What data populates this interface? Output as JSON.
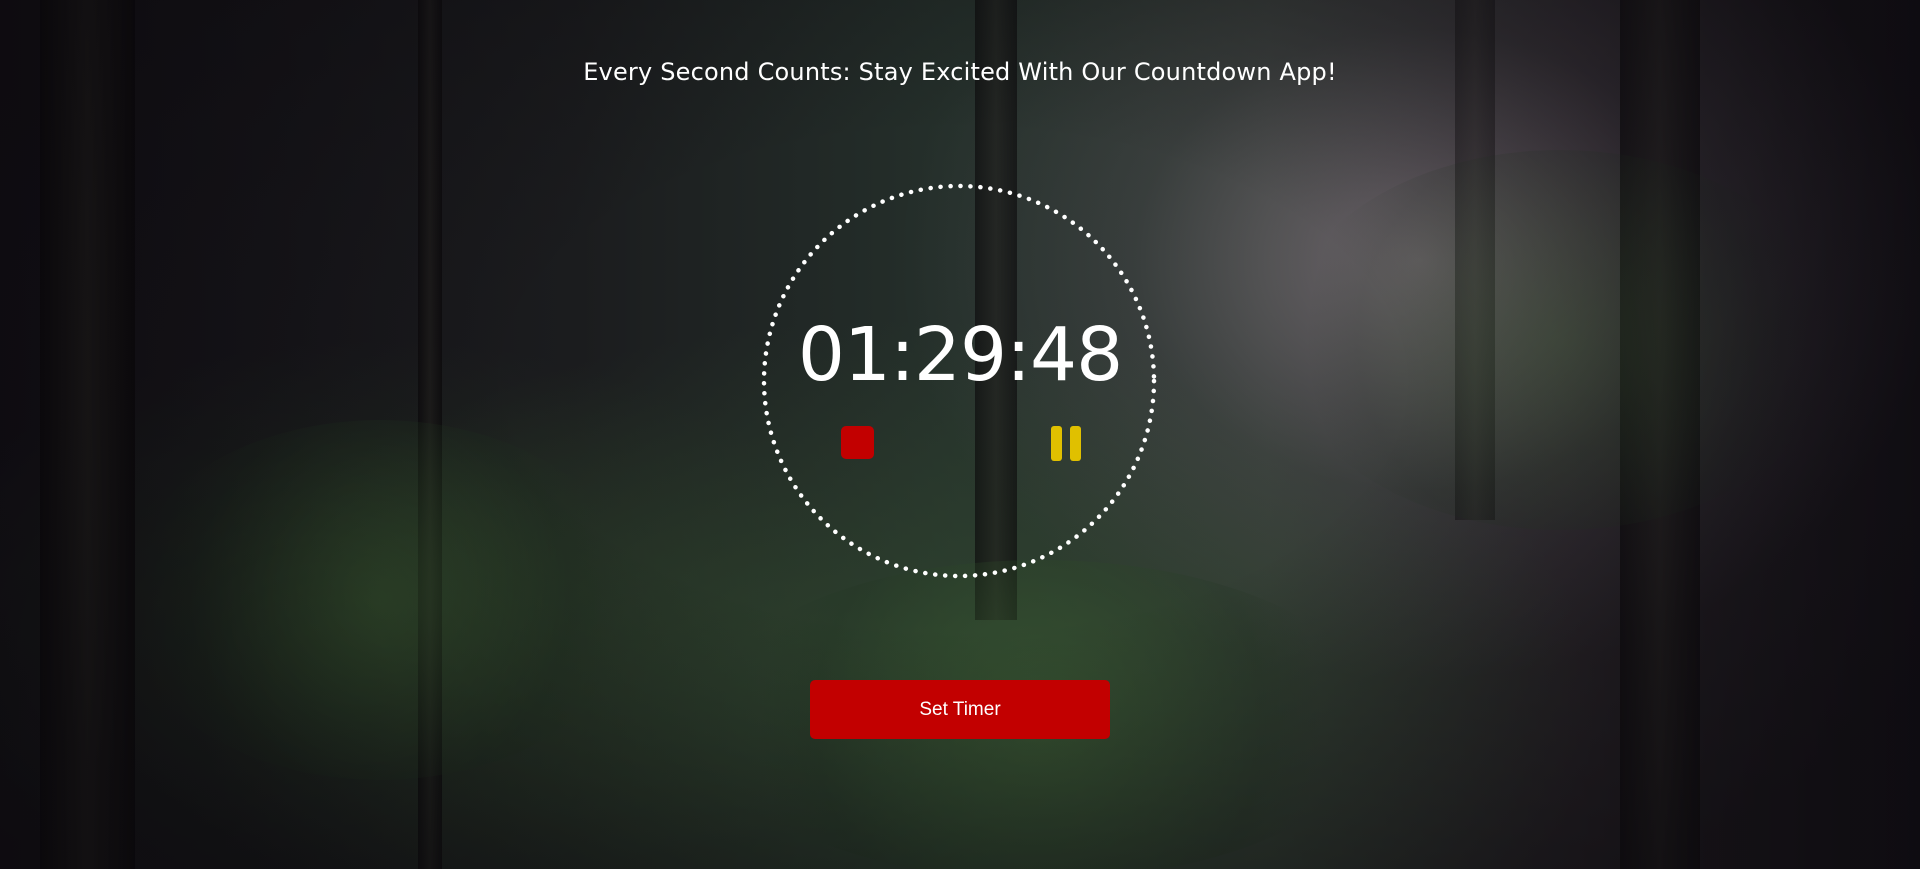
{
  "header": {
    "title": "Every Second Counts: Stay Excited With Our Countdown App!"
  },
  "timer": {
    "display": "01:29:48"
  },
  "controls": {
    "stop_icon": "stop-icon",
    "pause_icon": "pause-icon",
    "set_timer_label": "Set Timer"
  },
  "colors": {
    "accent_red": "#c20000",
    "pause_yellow": "#e0c000",
    "text": "#ffffff"
  }
}
